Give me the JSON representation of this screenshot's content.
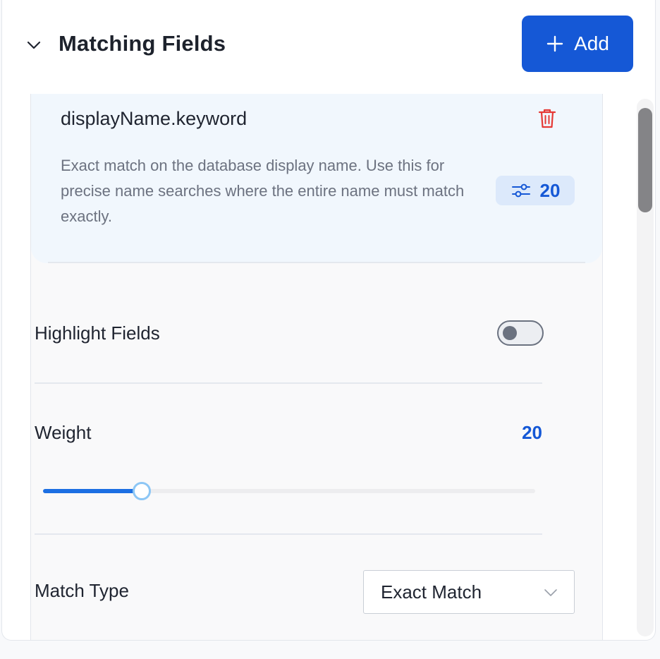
{
  "header": {
    "title": "Matching Fields",
    "add_label": "Add"
  },
  "field": {
    "name": "displayName.keyword",
    "description": "Exact match on the database display name. Use this for precise name searches where the entire name must match exactly.",
    "badge_value": "20"
  },
  "settings": {
    "highlight_label": "Highlight Fields",
    "highlight_enabled": false,
    "weight_label": "Weight",
    "weight_value": "20",
    "weight_fraction": 0.2,
    "match_type_label": "Match Type",
    "match_type_value": "Exact Match"
  },
  "colors": {
    "accent": "#1558d6",
    "delete": "#e53935",
    "card_bg": "#f1f7fd"
  },
  "icons": {
    "collapse": "chevron-down-icon",
    "add": "plus-icon",
    "delete": "trash-icon",
    "weight": "sliders-icon",
    "select": "chevron-down-icon"
  }
}
